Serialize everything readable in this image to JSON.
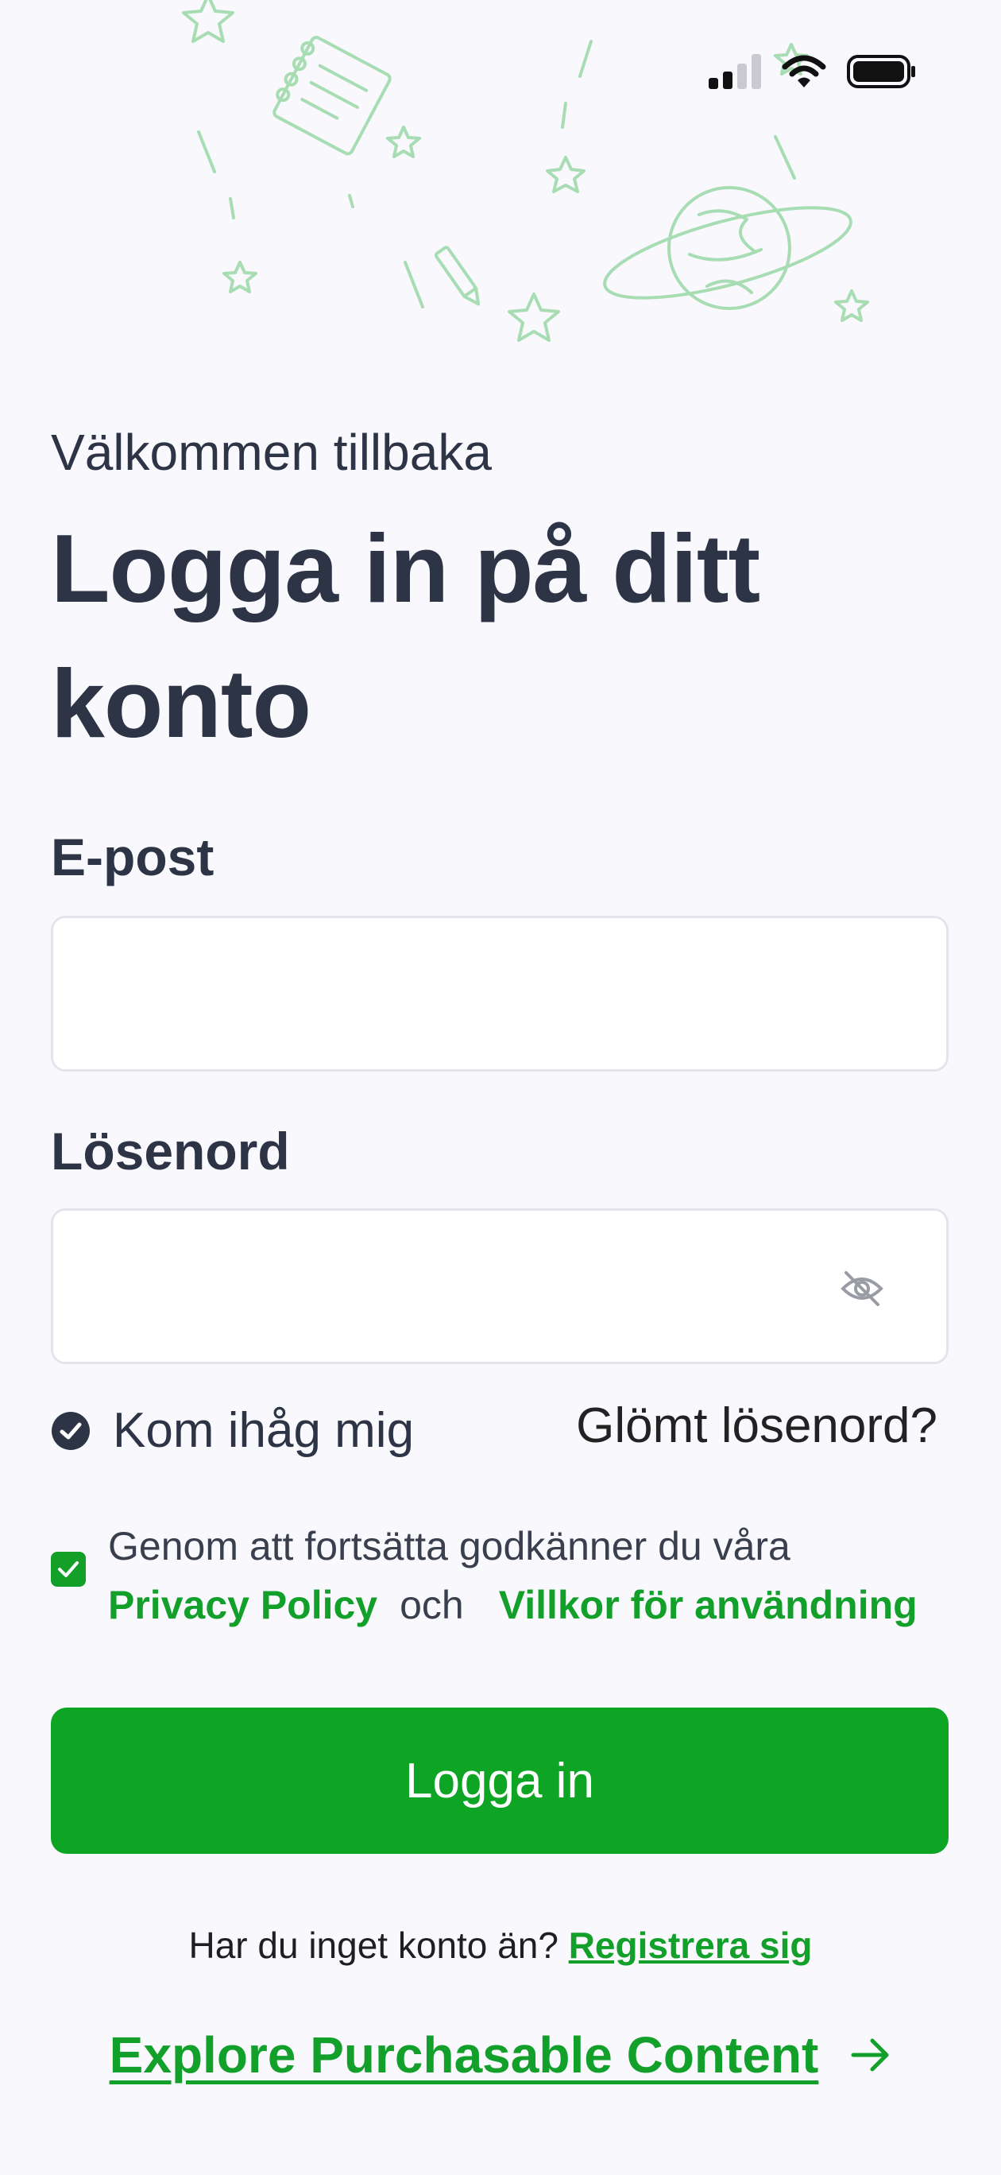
{
  "header": {
    "welcome": "Välkommen tillbaka",
    "title": "Logga in på ditt konto"
  },
  "form": {
    "email_label": "E-post",
    "email_value": "",
    "password_label": "Lösenord",
    "password_value": "",
    "password_toggle_icon": "eye-off-icon",
    "remember_label": "Kom ihåg mig",
    "remember_checked": true,
    "forgot_label": "Glömt lösenord?"
  },
  "terms": {
    "checked": true,
    "text": "Genom att fortsätta godkänner du våra",
    "privacy_link": "Privacy Policy",
    "conjunction": "och",
    "terms_link": "Villkor för användning"
  },
  "login_button": "Logga in",
  "register": {
    "prompt": "Har du inget konto än?",
    "link": "Registrera sig"
  },
  "explore": {
    "label": "Explore Purchasable Content",
    "icon": "arrow-right-icon"
  },
  "colors": {
    "accent": "#0fa524",
    "text": "#2d3446",
    "background": "#f8f8fd",
    "decoration": "#a8ddb4"
  }
}
